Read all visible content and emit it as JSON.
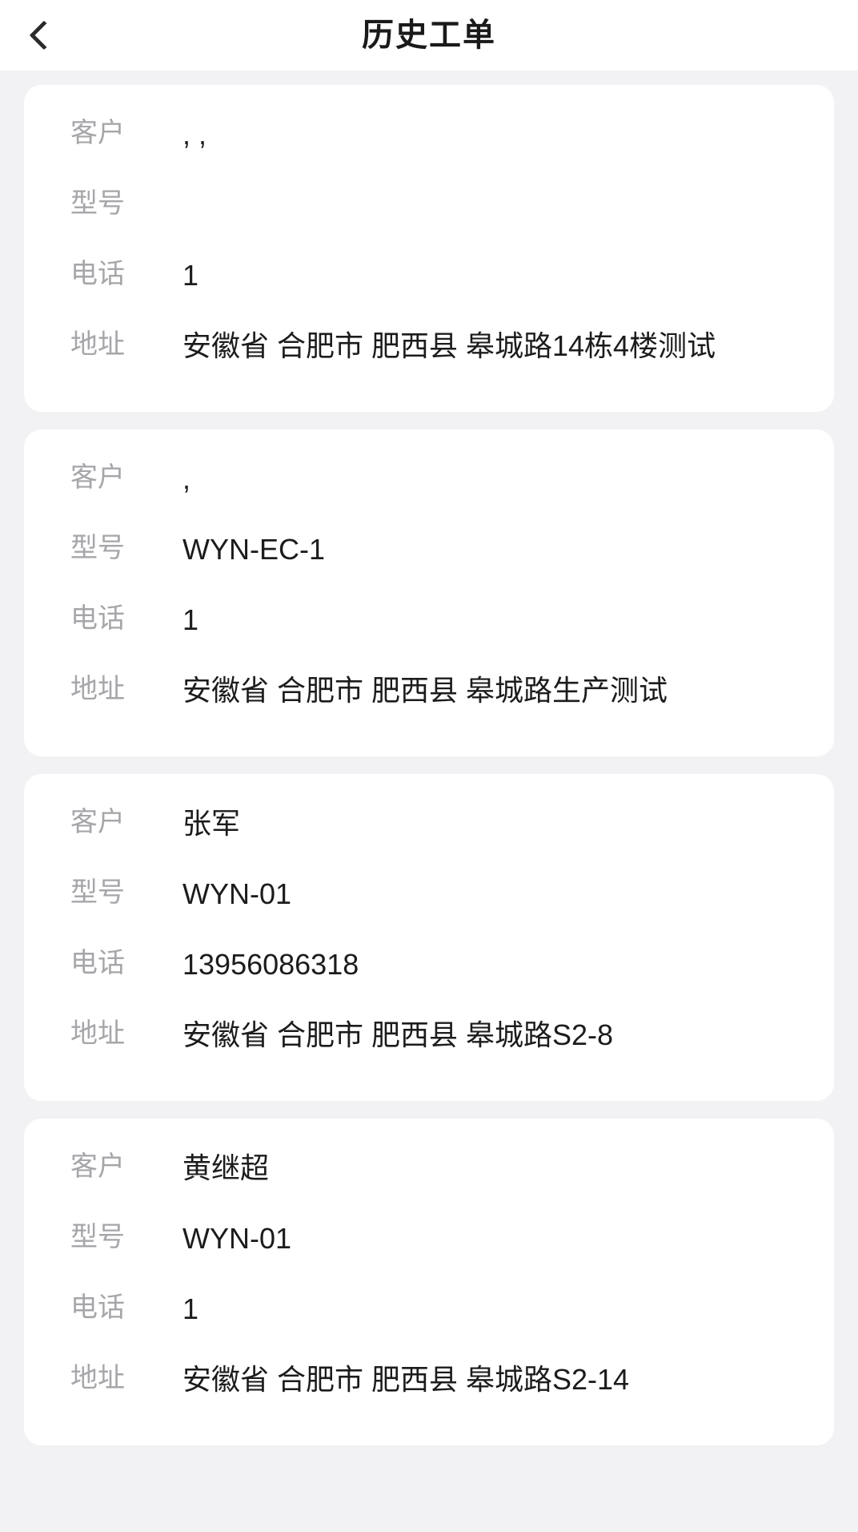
{
  "header": {
    "title": "历史工单",
    "back_icon": "chevron-left-icon"
  },
  "labels": {
    "customer": "客户",
    "model": "型号",
    "phone": "电话",
    "address": "地址"
  },
  "colors": {
    "page_background": "#f2f2f4",
    "card_background": "#ffffff",
    "label_text": "#a6a6aa",
    "value_text": "#1c1c1c",
    "title_text": "#1a1a1a"
  },
  "orders": [
    {
      "customer": ", ,",
      "model": "",
      "phone": "1",
      "address": "安徽省 合肥市 肥西县 皋城路14栋4楼测试"
    },
    {
      "customer": ",",
      "model": "WYN-EC-1",
      "phone": "1",
      "address": "安徽省 合肥市 肥西县 皋城路生产测试"
    },
    {
      "customer": "张军",
      "model": "WYN-01",
      "phone": "13956086318",
      "address": "安徽省 合肥市 肥西县 皋城路S2-8"
    },
    {
      "customer": "黄继超",
      "model": "WYN-01",
      "phone": "1",
      "address": "安徽省 合肥市 肥西县 皋城路S2-14"
    }
  ]
}
